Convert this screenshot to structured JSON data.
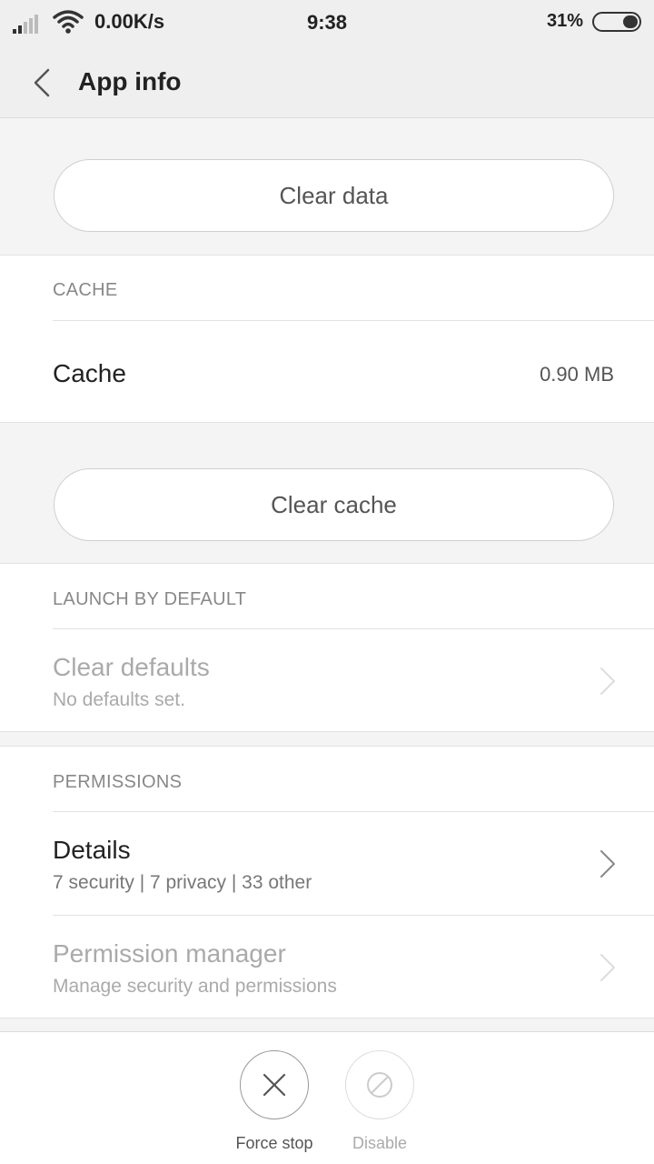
{
  "status_bar": {
    "network_speed": "0.00K/s",
    "time": "9:38",
    "battery_percent": "31%",
    "battery_level": 0.31
  },
  "header": {
    "title": "App info"
  },
  "storage": {
    "clear_data_label": "Clear data"
  },
  "cache": {
    "section_label": "CACHE",
    "row_label": "Cache",
    "row_value": "0.90 MB",
    "clear_cache_label": "Clear cache"
  },
  "launch_by_default": {
    "section_label": "LAUNCH BY DEFAULT",
    "row_title": "Clear defaults",
    "row_subtitle": "No defaults set."
  },
  "permissions": {
    "section_label": "PERMISSIONS",
    "details_title": "Details",
    "details_subtitle": "7 security | 7 privacy | 33 other",
    "manager_title": "Permission manager",
    "manager_subtitle": "Manage security and permissions"
  },
  "bottom_actions": {
    "force_stop_label": "Force stop",
    "disable_label": "Disable"
  },
  "icons": {
    "signal": "signal-icon",
    "wifi": "wifi-icon",
    "battery": "battery-icon",
    "back": "chevron-left-icon",
    "chevron": "chevron-right-icon",
    "force_stop": "close-icon",
    "disable": "block-icon"
  }
}
